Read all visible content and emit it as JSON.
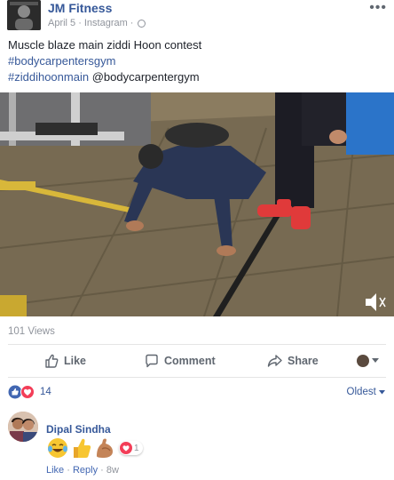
{
  "post": {
    "page_name": "JM Fitness",
    "date": "April 5",
    "source": "Instagram",
    "separator": "·",
    "more_label": "•••",
    "text_line1": "Muscle blaze main ziddi Hoon contest",
    "hashtag1": "#bodycarpentersgym",
    "hashtag2": "#ziddihoonmain",
    "mention": "@bodycarpentergym"
  },
  "video": {
    "views": "101 Views",
    "muted": true
  },
  "actions": {
    "like": "Like",
    "comment": "Comment",
    "share": "Share"
  },
  "reactions": {
    "count": "14",
    "types": [
      "like",
      "love"
    ],
    "sort_label": "Oldest"
  },
  "comment": {
    "author": "Dipal Sindha",
    "reaction_count": "1",
    "like": "Like",
    "reply": "Reply",
    "dot": "·",
    "time": "8w"
  },
  "colors": {
    "link": "#365899",
    "meta": "#90949c",
    "like_blue": "#4267b2",
    "love_red": "#f33e58"
  }
}
